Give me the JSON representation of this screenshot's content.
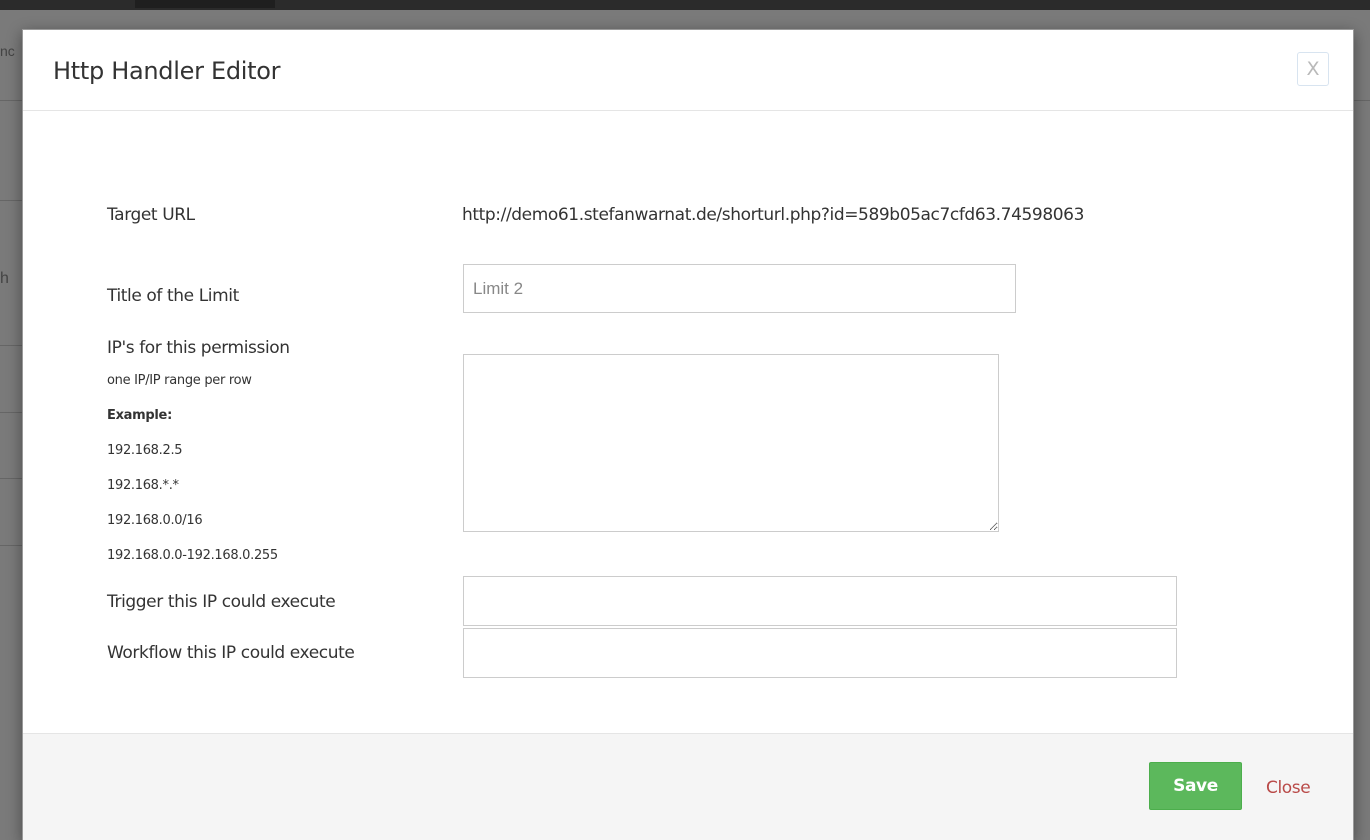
{
  "background": {
    "fragments": [
      "nc",
      "h"
    ]
  },
  "modal": {
    "title": "Http Handler Editor",
    "close_icon_label": "X",
    "fields": {
      "target_url": {
        "label": "Target URL",
        "value": "http://demo61.stefanwarnat.de/shorturl.php?id=589b05ac7cfd63.74598063"
      },
      "title": {
        "label": "Title of the Limit",
        "placeholder": "Limit 2",
        "value": ""
      },
      "ips": {
        "label": "IP's for this permission",
        "hint": "one IP/IP range per row",
        "example_label": "Example:",
        "examples": [
          "192.168.2.5",
          "192.168.*.*",
          "192.168.0.0/16",
          "192.168.0.0-192.168.0.255"
        ],
        "value": ""
      },
      "trigger": {
        "label": "Trigger this IP could execute",
        "value": ""
      },
      "workflow": {
        "label": "Workflow this IP could execute",
        "value": ""
      }
    },
    "footer": {
      "save_label": "Save",
      "close_label": "Close"
    }
  },
  "colors": {
    "save_button": "#5cb85c",
    "close_link": "#b94a48",
    "overlay": "#6b6b6b"
  }
}
